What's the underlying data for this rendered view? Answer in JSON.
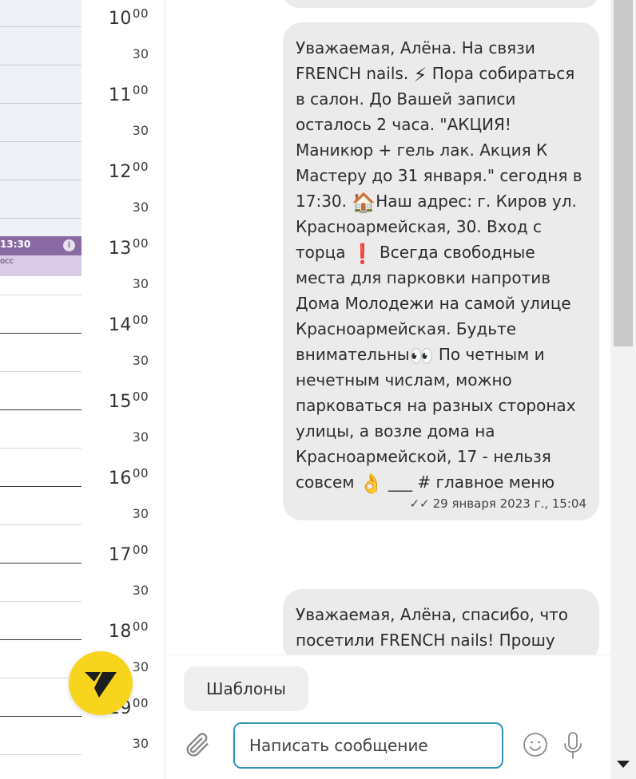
{
  "calendar": {
    "hours": [
      {
        "hour": "10",
        "mins": "00",
        "half": "30"
      },
      {
        "hour": "11",
        "mins": "00",
        "half": "30"
      },
      {
        "hour": "12",
        "mins": "00",
        "half": "30"
      },
      {
        "hour": "13",
        "mins": "00",
        "half": "30"
      },
      {
        "hour": "14",
        "mins": "00",
        "half": "30"
      },
      {
        "hour": "15",
        "mins": "00",
        "half": "30"
      },
      {
        "hour": "16",
        "mins": "00",
        "half": "30"
      },
      {
        "hour": "17",
        "mins": "00",
        "half": "30"
      },
      {
        "hour": "18",
        "mins": "00",
        "half": "30"
      },
      {
        "hour": "19",
        "mins": "00",
        "half": "30"
      }
    ],
    "event": {
      "time": "13:30",
      "subtitle": "осс"
    }
  },
  "chat": {
    "messages": [
      {
        "text_parts": [
          "Уважаемая, Алёна. На связи FRENCH nails. ",
          "⚡",
          " Пора собираться в салон. До Вашей записи осталось 2 часа. \"АКЦИЯ! Маникюр + гель лак. Акция К Мастеру до 31 января.\" сегодня в 17:30. ",
          "🏠",
          "Наш адрес: г. Киров ул. Красноармейская, 30. Вход с торца ",
          "❗",
          " Всегда свободные места для парковки напротив Дома Молодежи на самой улице Красноармейская. Будьте внимательны",
          "👀",
          " По четным и нечетным числам, можно парковаться на разных сторонах улицы, а возле дома на Красноармейской, 17 - нельзя совсем ",
          "👌",
          " ___ # главное меню"
        ],
        "timestamp": "29 января 2023 г., 15:04",
        "status_icon": "double-check-icon"
      },
      {
        "text": "Уважаемая, Алёна, спасибо, что посетили FRENCH nails! Прошу"
      }
    ]
  },
  "composer": {
    "templates_label": "Шаблоны",
    "input_placeholder": "Написать сообщение",
    "input_value": ""
  },
  "colors": {
    "bubble": "#ebebeb",
    "input_border": "#2e96b4",
    "logo": "#f7d51c",
    "event_bar": "#8a6aa2",
    "event_body": "#d9cbe6"
  },
  "icons": [
    "attach-icon",
    "emoji-icon",
    "microphone-icon",
    "logo-icon",
    "info-icon",
    "double-check-icon",
    "scroll-down-arrow-icon"
  ]
}
